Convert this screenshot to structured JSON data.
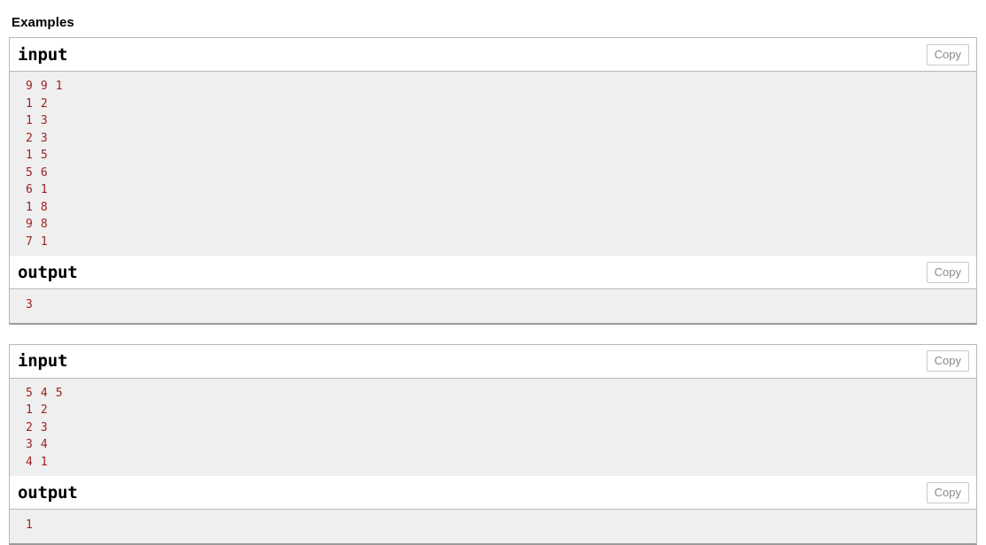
{
  "section": {
    "title": "Examples"
  },
  "labels": {
    "input": "input",
    "output": "output",
    "copy": "Copy"
  },
  "colors": {
    "code_text": "#9c2222",
    "code_background": "#efefef",
    "header_background": "#ffffff",
    "border": "#b8b8b8",
    "copy_text": "#8a8a8a"
  },
  "examples": [
    {
      "input": "9 9 1\n1 2\n1 3\n2 3\n1 5\n5 6\n6 1\n1 8\n9 8\n7 1",
      "output": "3"
    },
    {
      "input": "5 4 5\n1 2\n2 3\n3 4\n4 1",
      "output": "1"
    }
  ]
}
